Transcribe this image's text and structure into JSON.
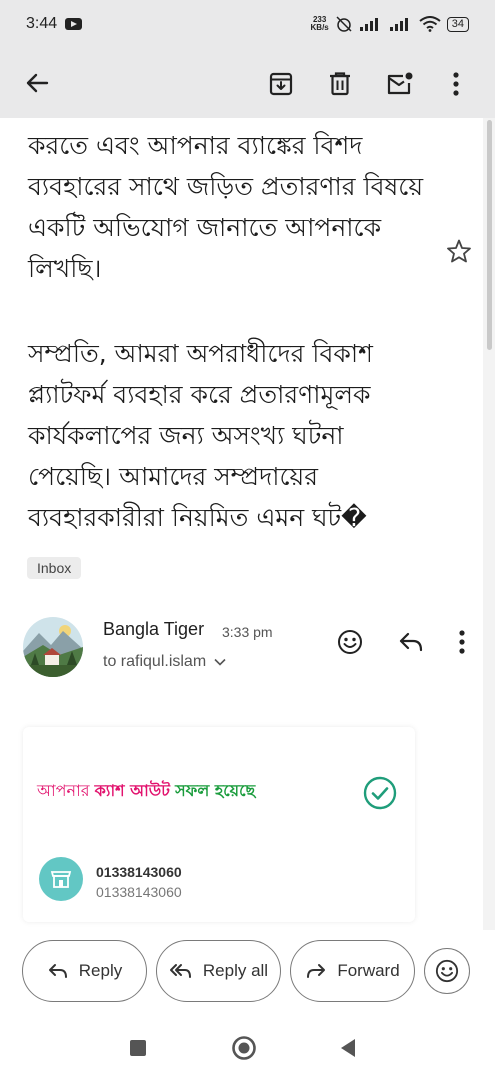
{
  "status_bar": {
    "time": "3:44",
    "net_speed_value": "233",
    "net_speed_unit": "KB/s",
    "battery": "34"
  },
  "toolbar": {
    "back_icon": "arrow-left-icon",
    "archive_icon": "archive-icon",
    "delete_icon": "trash-icon",
    "unread_icon": "mark-unread-icon",
    "more_icon": "more-vert-icon"
  },
  "email_body": {
    "paragraph_1": "করতে এবং আপনার ব্যাঙ্কের বিশদ ব্যবহারের সাথে জড়িত প্রতারণার বিষয়ে একটি অভিযোগ জানাতে আপনাকে লিখছি।",
    "paragraph_2": "সম্প্রতি, আমরা অপরাধীদের বিকাশ প্ল্যাটফর্ম ব্যবহার করে প্রতারণামূলক কার্যকলাপের জন্য অসংখ্য ঘটনা পেয়েছি। আমাদের সম্প্রদায়ের ব্যবহারকারীরা নিয়মিত এমন ঘট�"
  },
  "label": "Inbox",
  "message": {
    "sender_name": "Bangla Tiger",
    "time": "3:33 pm",
    "recipient": "to rafiqul.islam"
  },
  "card": {
    "part1": "আপনার ",
    "part2": "ক্যাশ আউট",
    "part3": "সফল হয়েছে",
    "account_number": "01338143060",
    "account_sub": "01338143060"
  },
  "actions": {
    "reply": "Reply",
    "reply_all": "Reply all",
    "forward": "Forward"
  },
  "colors": {
    "bkash_pink": "#e2136e",
    "success_green": "#1a9c3c",
    "check_teal": "#1f9d7a",
    "chrome_gray": "#e9e9ea"
  }
}
